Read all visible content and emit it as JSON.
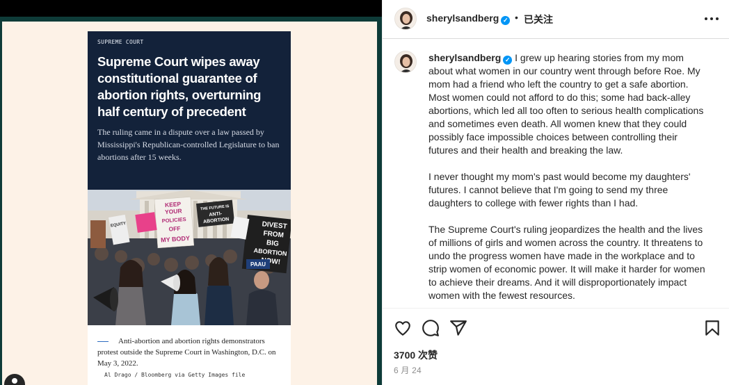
{
  "post": {
    "username": "sherylsandberg",
    "follow_status": "已关注",
    "separator": "•",
    "likes": "3700 次赞",
    "date": "6 月 24"
  },
  "media": {
    "kicker": "SUPREME COURT",
    "headline": "Supreme Court wipes away constitutional guarantee of abortion rights, overturning half century of precedent",
    "dek": "The ruling came in a dispute over a law passed by Mississippi's Republican-controlled Legislature to ban abortions after 15 weeks.",
    "photo_signs": {
      "sign_1": "KEEP YOUR POLICIES OFF MY BODY",
      "sign_2": "THE FUTURE IS ANTI-ABORTION",
      "sign_3": "DIVEST FROM BIG ABORTION NOW!",
      "sign_4": "PAAU",
      "sign_5": "EQUITY"
    },
    "caption": "Anti-abortion and abortion rights demonstrators protest outside the Supreme Court in Washington, D.C. on May 3, 2022.",
    "credit": "Al Drago / Bloomberg via Getty Images file"
  },
  "caption": {
    "paragraphs": [
      "I grew up hearing stories from my mom about what women in our country went through before Roe. My mom had a friend who left the country to get a safe abortion. Most women could not afford to do this; some had back-alley abortions, which led all too often to serious health complications and sometimes even death. All women knew that they could possibly face impossible choices between controlling their futures and their health and breaking the law.",
      "I never thought my mom's past would become my daughters' futures. I cannot believe that I'm going to send my three daughters to college with fewer rights than I had.",
      "The Supreme Court's ruling jeopardizes the health and the lives of millions of girls and women across the country. It threatens to undo the progress women have made in the workplace and to strip women of economic power. It will make it harder for women to achieve their dreams. And it will disproportionately impact women with the fewest resources."
    ]
  },
  "icons": {
    "like": "heart-icon",
    "comment": "speech-bubble-icon",
    "share": "paper-plane-icon",
    "save": "bookmark-icon",
    "more": "more-dots-icon",
    "verified": "verified-badge-icon"
  },
  "colors": {
    "verified": "#0095f6",
    "article_navy": "#13223a",
    "frame_teal": "#0e3b38",
    "card_cream": "#fdf2e7"
  }
}
